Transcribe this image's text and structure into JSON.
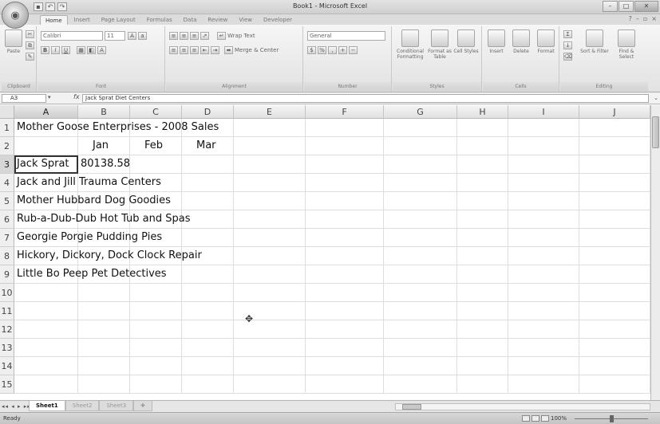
{
  "window": {
    "title": "Book1 - Microsoft Excel",
    "office_icon": "office-logo-icon"
  },
  "ribbon": {
    "tabs": [
      {
        "label": "Home",
        "active": true
      },
      {
        "label": "Insert"
      },
      {
        "label": "Page Layout"
      },
      {
        "label": "Formulas"
      },
      {
        "label": "Data"
      },
      {
        "label": "Review"
      },
      {
        "label": "View"
      },
      {
        "label": "Developer"
      }
    ],
    "clipboard": {
      "paste_label": "Paste",
      "group_label": "Clipboard"
    },
    "font": {
      "font_name": "Calibri",
      "font_size": "11",
      "group_label": "Font"
    },
    "alignment": {
      "wrap_label": "Wrap Text",
      "merge_label": "Merge & Center",
      "group_label": "Alignment"
    },
    "number": {
      "format": "General",
      "group_label": "Number"
    },
    "styles": {
      "cond_label": "Conditional Formatting",
      "format_table_label": "Format as Table",
      "cell_styles_label": "Cell Styles",
      "group_label": "Styles"
    },
    "cells": {
      "insert_label": "Insert",
      "delete_label": "Delete",
      "format_label": "Format",
      "group_label": "Cells"
    },
    "editing": {
      "sort_label": "Sort & Filter",
      "find_label": "Find & Select",
      "group_label": "Editing"
    }
  },
  "formula_bar": {
    "name_box": "A3",
    "formula": "Jack Sprat Diet Centers"
  },
  "grid": {
    "columns": [
      "A",
      "B",
      "C",
      "D",
      "E",
      "F",
      "G",
      "H",
      "I",
      "J"
    ],
    "rows": [
      {
        "num": "1",
        "a": "Mother Goose Enterprises - 2008 Sales",
        "b": "",
        "c": "",
        "d": ""
      },
      {
        "num": "2",
        "a": "",
        "b": "Jan",
        "c": "Feb",
        "d": "Mar"
      },
      {
        "num": "3",
        "a": "Jack Sprat",
        "b": "80138.58",
        "c": "",
        "d": ""
      },
      {
        "num": "4",
        "a": "Jack and Jill Trauma Centers",
        "b": "",
        "c": "",
        "d": ""
      },
      {
        "num": "5",
        "a": "Mother Hubbard Dog Goodies",
        "b": "",
        "c": "",
        "d": ""
      },
      {
        "num": "6",
        "a": "Rub-a-Dub-Dub Hot Tub and Spas",
        "b": "",
        "c": "",
        "d": ""
      },
      {
        "num": "7",
        "a": "Georgie Porgie Pudding Pies",
        "b": "",
        "c": "",
        "d": ""
      },
      {
        "num": "8",
        "a": "Hickory, Dickory, Dock Clock Repair",
        "b": "",
        "c": "",
        "d": ""
      },
      {
        "num": "9",
        "a": "Little Bo Peep Pet Detectives",
        "b": "",
        "c": "",
        "d": ""
      },
      {
        "num": "10",
        "a": "",
        "b": "",
        "c": "",
        "d": ""
      },
      {
        "num": "11",
        "a": "",
        "b": "",
        "c": "",
        "d": ""
      },
      {
        "num": "12",
        "a": "",
        "b": "",
        "c": "",
        "d": ""
      },
      {
        "num": "13",
        "a": "",
        "b": "",
        "c": "",
        "d": ""
      },
      {
        "num": "14",
        "a": "",
        "b": "",
        "c": "",
        "d": ""
      },
      {
        "num": "15",
        "a": "",
        "b": "",
        "c": "",
        "d": ""
      }
    ],
    "active_cell": "A3"
  },
  "sheets": {
    "tabs": [
      {
        "label": "Sheet1",
        "active": true
      },
      {
        "label": "Sheet2"
      },
      {
        "label": "Sheet3"
      }
    ]
  },
  "status": {
    "mode": "Ready",
    "zoom": "100%"
  }
}
